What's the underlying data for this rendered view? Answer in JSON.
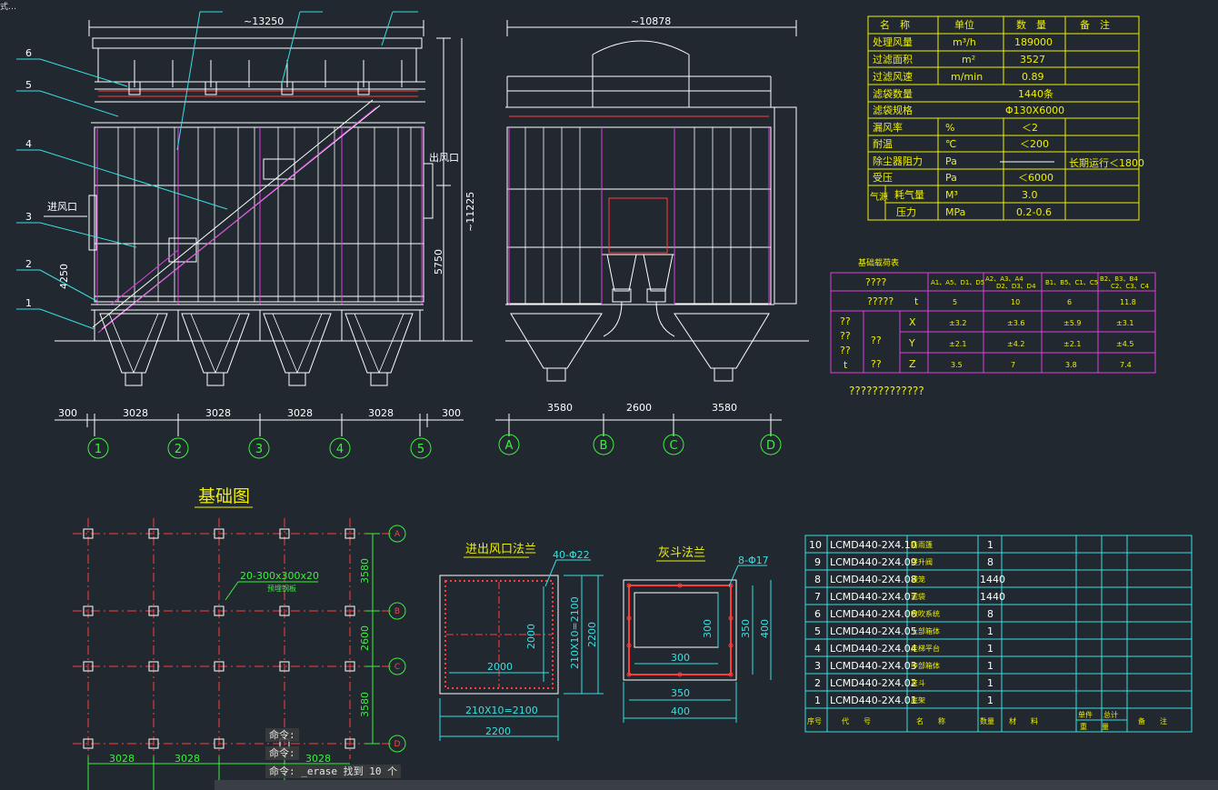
{
  "window": {
    "title_fragment": "式…"
  },
  "colors": {
    "bg": "#212830",
    "white": "#ffffff",
    "red": "#ff3b3b",
    "magenta": "#e040e0",
    "green": "#3cf03c",
    "yellow": "#f0f000",
    "cyan": "#38e0e0"
  },
  "elevation": {
    "overall_width": "~13250",
    "height_total": "~11225",
    "dim_5750": "5750",
    "dim_4250": "4250",
    "inlet": "进风口",
    "outlet": "出风口",
    "callouts": [
      "6",
      "5",
      "4",
      "3",
      "2",
      "1"
    ],
    "spans": [
      "300",
      "3028",
      "3028",
      "3028",
      "3028",
      "300"
    ],
    "axes": [
      "1",
      "2",
      "3",
      "4",
      "5"
    ]
  },
  "side": {
    "overall_width": "~10878",
    "spans": [
      "3580",
      "2600",
      "3580"
    ],
    "axes": [
      "A",
      "B",
      "C",
      "D"
    ]
  },
  "spec_table": {
    "header": [
      "名　称",
      "单位",
      "数　量",
      "备　注"
    ],
    "rows": [
      [
        "处理风量",
        "m³/h",
        "189000",
        ""
      ],
      [
        "过滤面积",
        "m²",
        "3527",
        ""
      ],
      [
        "过滤风速",
        "m/min",
        "0.89",
        ""
      ],
      [
        "滤袋数量",
        "",
        "1440条",
        ""
      ],
      [
        "滤袋规格",
        "",
        "Φ130X6000",
        ""
      ],
      [
        "漏风率",
        "%",
        "＜2",
        ""
      ],
      [
        "耐温",
        "℃",
        "＜200",
        ""
      ],
      [
        "除尘器阻力",
        "Pa",
        "",
        "长期运行＜1800"
      ],
      [
        "受压",
        "Pa",
        "＜6000",
        ""
      ]
    ],
    "air_group": "气源",
    "air_rows": [
      [
        "耗气量",
        "M³",
        "3.0"
      ],
      [
        "压力",
        "MPa",
        "0.2-0.6"
      ]
    ]
  },
  "load_table": {
    "title": "基础载荷表",
    "h1": "????",
    "col_headers": [
      "A1、A5、D1、D5",
      "A2、A3、A4",
      "D2、D3、D4",
      "B1、B5、C1、C5",
      "B2、B3、B4",
      "C2、C3、C4"
    ],
    "t_label": "?????",
    "t_unit": "t",
    "t_values": [
      "5",
      "10",
      "6",
      "11.8"
    ],
    "side_l1": "??",
    "side_l2": "??",
    "side_l3": "??",
    "side_t": "t",
    "mid_a": "??",
    "mid_b": "??",
    "axes": [
      "X",
      "Y",
      "Z"
    ],
    "x_values": [
      "±3.2",
      "±3.6",
      "±5.9",
      "±3.1"
    ],
    "y_values": [
      "±2.1",
      "±4.2",
      "±2.1",
      "±4.5"
    ],
    "z_values": [
      "3.5",
      "7",
      "3.8",
      "7.4"
    ],
    "note": "?????????????"
  },
  "foundation": {
    "title": "基础图",
    "embed": "20-300x300x20",
    "embed_sub": "预埋钢板",
    "dims_v": [
      "3580",
      "2600",
      "3580"
    ],
    "dims_h": [
      "3028",
      "3028",
      "3028"
    ],
    "row_axes": [
      "A",
      "B",
      "C",
      "D"
    ]
  },
  "flange_io": {
    "title": "进出风口法兰",
    "holes": "40-Φ22",
    "d_2000h": "2000",
    "d_2000v": "2000",
    "d_2100v": "210X10=2100",
    "d_2200v": "2200",
    "d_2100h": "210X10=2100",
    "d_2200h": "2200"
  },
  "flange_hopper": {
    "title": "灰斗法兰",
    "holes": "8-Φ17",
    "d_300h": "300",
    "d_300v": "300",
    "d_350v": "350",
    "d_400v": "400",
    "d_350h": "350",
    "d_400h": "400"
  },
  "parts": {
    "rows": [
      [
        "10",
        "LCMD440-2X4.10",
        "防雨篷",
        "1"
      ],
      [
        "9",
        "LCMD440-2X4.09",
        "提升阀",
        "8"
      ],
      [
        "8",
        "LCMD440-2X4.08",
        "袋笼",
        "1440"
      ],
      [
        "7",
        "LCMD440-2X4.07",
        "滤袋",
        "1440"
      ],
      [
        "6",
        "LCMD440-2X4.06",
        "喷吹系统",
        "8"
      ],
      [
        "5",
        "LCMD440-2X4.05",
        "上部箱体",
        "1"
      ],
      [
        "4",
        "LCMD440-2X4.04",
        "走梯平台",
        "1"
      ],
      [
        "3",
        "LCMD440-2X4.03",
        "中部箱体",
        "1"
      ],
      [
        "2",
        "LCMD440-2X4.02",
        "灰斗",
        "1"
      ],
      [
        "1",
        "LCMD440-2X4.01",
        "底架",
        "1"
      ]
    ],
    "footer": {
      "no": "序号",
      "code": "代　　号",
      "name": "名　　称",
      "qty": "数量",
      "mat": "材　　料",
      "w1": "单件",
      "w2": "总计",
      "w3": "重　　量",
      "note": "备　　注"
    }
  },
  "command_line": {
    "l1": "命令:",
    "l2": "命令:",
    "l3": "命令: _erase 找到 10 个"
  }
}
